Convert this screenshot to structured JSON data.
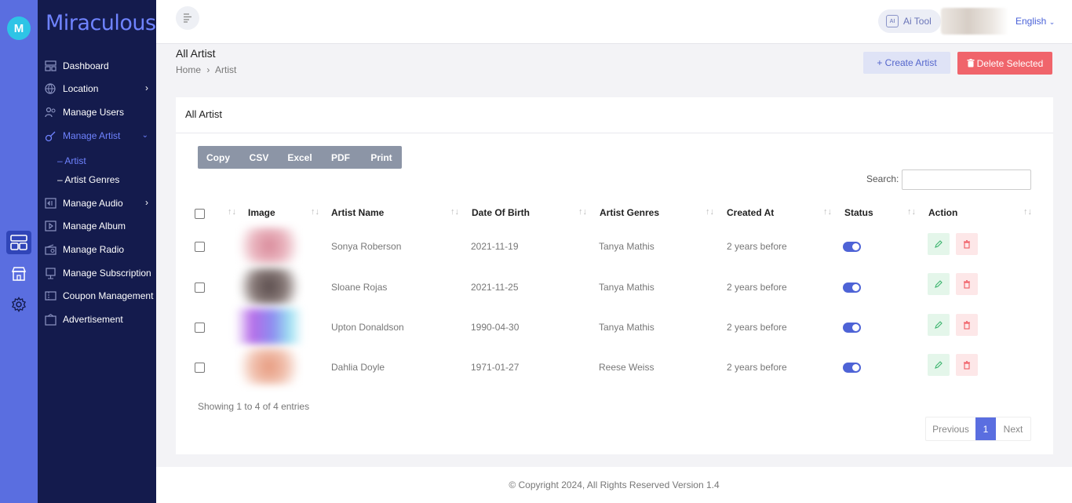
{
  "rail": {
    "logo_letter": "M"
  },
  "sidebar": {
    "brand": "Miraculous",
    "items": [
      {
        "label": "Dashboard",
        "icon": "dashboard-icon"
      },
      {
        "label": "Location",
        "icon": "globe-icon",
        "has_chevron": true
      },
      {
        "label": "Manage Users",
        "icon": "users-icon"
      },
      {
        "label": "Manage Artist",
        "icon": "guitar-icon",
        "expanded": true,
        "active": true
      },
      {
        "label": "Manage Audio",
        "icon": "audio-icon",
        "has_chevron": true
      },
      {
        "label": "Manage Album",
        "icon": "album-icon"
      },
      {
        "label": "Manage Radio",
        "icon": "radio-icon"
      },
      {
        "label": "Manage Subscription",
        "icon": "subscription-icon"
      },
      {
        "label": "Coupon Management",
        "icon": "coupon-icon"
      },
      {
        "label": "Advertisement",
        "icon": "advertisement-icon"
      }
    ],
    "sub_items": [
      {
        "label": "– Artist",
        "active": true
      },
      {
        "label": "– Artist Genres",
        "active": false
      }
    ]
  },
  "topbar": {
    "ai_tool_label": "Ai Tool",
    "ai_icon_text": "AI",
    "language": "English"
  },
  "page": {
    "title": "All Artist",
    "breadcrumb_home": "Home",
    "breadcrumb_sep": "›",
    "breadcrumb_current": "Artist",
    "create_label": "+  Create Artist",
    "delete_label": "Delete Selected"
  },
  "card": {
    "title": "All Artist",
    "export_buttons": [
      "Copy",
      "CSV",
      "Excel",
      "PDF",
      "Print"
    ],
    "search_label": "Search:",
    "search_value": "",
    "columns": [
      "Image",
      "Artist Name",
      "Date Of Birth",
      "Artist Genres",
      "Created At",
      "Status",
      "Action"
    ],
    "rows": [
      {
        "name": "Sonya Roberson",
        "dob": "2021-11-19",
        "genre": "Tanya Mathis",
        "created": "2 years before",
        "status": true
      },
      {
        "name": "Sloane Rojas",
        "dob": "2021-11-25",
        "genre": "Tanya Mathis",
        "created": "2 years before",
        "status": true
      },
      {
        "name": "Upton Donaldson",
        "dob": "1990-04-30",
        "genre": "Tanya Mathis",
        "created": "2 years before",
        "status": true
      },
      {
        "name": "Dahlia Doyle",
        "dob": "1971-01-27",
        "genre": "Reese Weiss",
        "created": "2 years before",
        "status": true
      }
    ],
    "showing_text": "Showing 1 to 4 of 4 entries",
    "pagination": {
      "previous": "Previous",
      "current": "1",
      "next": "Next"
    }
  },
  "footer": {
    "text": "© Copyright 2024, All Rights Reserved Version 1.4"
  },
  "colors": {
    "rail": "#5a6ee0",
    "sidebar": "#141b4d",
    "accent": "#6f83ff",
    "delete": "#f0646b",
    "export": "#8c95a6"
  }
}
